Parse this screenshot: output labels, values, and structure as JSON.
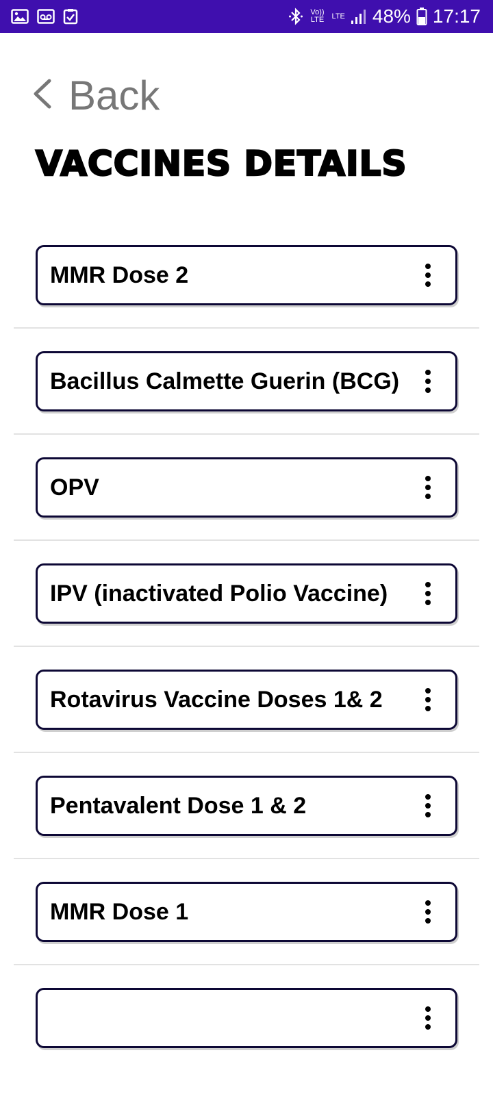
{
  "status_bar": {
    "battery": "48%",
    "time": "17:17",
    "network_volte": "Vo)) LTE",
    "network_lte": "LTE",
    "icons": [
      "gallery-icon",
      "voicemail-icon",
      "clipboard-check-icon",
      "bluetooth-icon",
      "volte-icon",
      "lte-icon",
      "signal-icon",
      "battery-icon"
    ]
  },
  "header": {
    "back_label": "Back",
    "title": "VACCINES DETAILS"
  },
  "vaccines": [
    {
      "label": "MMR Dose 2"
    },
    {
      "label": "Bacillus Calmette Guerin (BCG)"
    },
    {
      "label": "OPV"
    },
    {
      "label": "IPV (inactivated Polio Vaccine)"
    },
    {
      "label": "Rotavirus Vaccine Doses 1& 2"
    },
    {
      "label": "Pentavalent Dose 1 & 2"
    },
    {
      "label": "MMR Dose 1"
    }
  ],
  "colors": {
    "status_bar": "#3f0fae",
    "card_border": "#0d0835",
    "back_text": "#777777"
  }
}
